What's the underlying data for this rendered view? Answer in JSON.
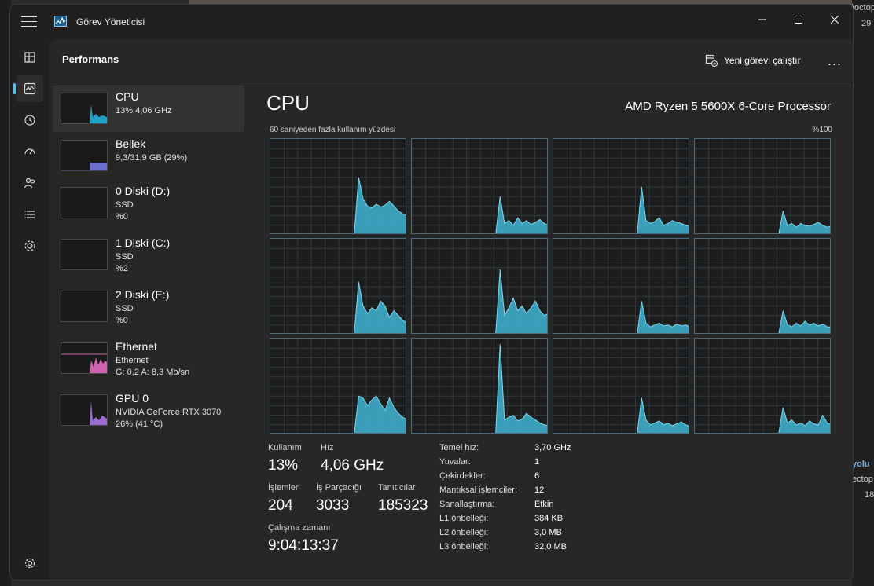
{
  "app": {
    "title": "Görev Yöneticisi"
  },
  "background": {
    "right_text_1": "\\octop",
    "right_text_2": "29",
    "right_text_3": "yolu",
    "right_text_4": "ectop",
    "right_text_5": "18"
  },
  "nav": {
    "items": [
      "performance-icon",
      "processes-icon",
      "history-icon",
      "startup-icon",
      "users-icon",
      "details-icon",
      "services-icon",
      "settings-icon"
    ]
  },
  "header": {
    "title": "Performans",
    "run_new_task": "Yeni görevi çalıştır",
    "more": "..."
  },
  "devices": [
    {
      "name": "CPU",
      "line1": "13% 4,06 GHz",
      "line2": "",
      "color": "#21a0c8"
    },
    {
      "name": "Bellek",
      "line1": "9,3/31,9 GB (29%)",
      "line2": "",
      "color": "#6b6fd0"
    },
    {
      "name": "0 Diski (D:)",
      "line1": "SSD",
      "line2": "%0",
      "color": "#63b95a"
    },
    {
      "name": "1 Diski (C:)",
      "line1": "SSD",
      "line2": "%2",
      "color": "#63b95a"
    },
    {
      "name": "2 Diski (E:)",
      "line1": "SSD",
      "line2": "%0",
      "color": "#63b95a"
    },
    {
      "name": "Ethernet",
      "line1": "Ethernet",
      "line2": "G: 0,2 A: 8,3 Mb/sn",
      "color": "#d063b0"
    },
    {
      "name": "GPU 0",
      "line1": "NVIDIA GeForce RTX 3070",
      "line2": "26% (41 °C)",
      "color": "#9a6bd0"
    }
  ],
  "cpu": {
    "title": "CPU",
    "model": "AMD Ryzen 5 5600X 6-Core Processor",
    "graph_label": "60 saniyeden fazla kullanım yüzdesi",
    "graph_max": "%100",
    "fill_color": "#3fb5d4",
    "line_color": "#7fd6ec"
  },
  "stats": {
    "usage_label": "Kullanım",
    "usage_value": "13%",
    "speed_label": "Hız",
    "speed_value": "4,06 GHz",
    "processes_label": "İşlemler",
    "processes_value": "204",
    "threads_label": "İş Parçacığı",
    "threads_value": "3033",
    "handles_label": "Tanıtıcılar",
    "handles_value": "185323",
    "uptime_label": "Çalışma zamanı",
    "uptime_value": "9:04:13:37"
  },
  "info": [
    {
      "key": "Temel hız:",
      "value": "3,70 GHz"
    },
    {
      "key": "Yuvalar:",
      "value": "1"
    },
    {
      "key": "Çekirdekler:",
      "value": "6"
    },
    {
      "key": "Mantıksal işlemciler:",
      "value": "12"
    },
    {
      "key": "Sanallaştırma:",
      "value": "Etkin"
    },
    {
      "key": "L1 önbelleği:",
      "value": "384 KB"
    },
    {
      "key": "L2 önbelleği:",
      "value": "3,0 MB"
    },
    {
      "key": "L3 önbelleği:",
      "value": "32,0 MB"
    }
  ],
  "chart_data": {
    "type": "area",
    "title": "60 saniyeden fazla kullanım yüzdesi",
    "ylim": [
      0,
      100
    ],
    "series": [
      {
        "values": [
          0,
          0,
          0,
          0,
          0,
          0,
          0,
          0,
          0,
          0,
          0,
          0,
          0,
          0,
          0,
          0,
          0,
          0,
          0,
          0,
          60,
          38,
          30,
          28,
          32,
          29,
          31,
          35,
          30,
          25,
          22,
          20
        ]
      },
      {
        "values": [
          0,
          0,
          0,
          0,
          0,
          0,
          0,
          0,
          0,
          0,
          0,
          0,
          0,
          0,
          0,
          0,
          0,
          0,
          0,
          0,
          40,
          12,
          15,
          10,
          18,
          12,
          15,
          11,
          13,
          16,
          12,
          10
        ]
      },
      {
        "values": [
          0,
          0,
          0,
          0,
          0,
          0,
          0,
          0,
          0,
          0,
          0,
          0,
          0,
          0,
          0,
          0,
          0,
          0,
          0,
          0,
          50,
          15,
          12,
          14,
          18,
          10,
          12,
          15,
          13,
          12,
          10,
          9
        ]
      },
      {
        "values": [
          0,
          0,
          0,
          0,
          0,
          0,
          0,
          0,
          0,
          0,
          0,
          0,
          0,
          0,
          0,
          0,
          0,
          0,
          0,
          0,
          25,
          10,
          12,
          8,
          12,
          10,
          9,
          11,
          13,
          10,
          8,
          9
        ]
      },
      {
        "values": [
          0,
          0,
          0,
          0,
          0,
          0,
          0,
          0,
          0,
          0,
          0,
          0,
          0,
          0,
          0,
          0,
          0,
          0,
          0,
          0,
          55,
          30,
          22,
          28,
          25,
          35,
          30,
          18,
          25,
          20,
          15,
          12
        ]
      },
      {
        "values": [
          0,
          0,
          0,
          0,
          0,
          0,
          0,
          0,
          0,
          0,
          0,
          0,
          0,
          0,
          0,
          0,
          0,
          0,
          0,
          0,
          68,
          20,
          28,
          38,
          25,
          30,
          22,
          28,
          35,
          25,
          20,
          22
        ]
      },
      {
        "values": [
          0,
          0,
          0,
          0,
          0,
          0,
          0,
          0,
          0,
          0,
          0,
          0,
          0,
          0,
          0,
          0,
          0,
          0,
          0,
          0,
          35,
          12,
          8,
          10,
          12,
          9,
          10,
          8,
          11,
          9,
          10,
          8
        ]
      },
      {
        "values": [
          0,
          0,
          0,
          0,
          0,
          0,
          0,
          0,
          0,
          0,
          0,
          0,
          0,
          0,
          0,
          0,
          0,
          0,
          0,
          0,
          25,
          10,
          8,
          12,
          9,
          14,
          10,
          12,
          9,
          11,
          8,
          8
        ]
      },
      {
        "values": [
          0,
          0,
          0,
          0,
          0,
          0,
          0,
          0,
          0,
          0,
          0,
          0,
          0,
          0,
          0,
          0,
          0,
          0,
          0,
          0,
          40,
          38,
          30,
          36,
          40,
          32,
          25,
          38,
          28,
          22,
          18,
          15
        ]
      },
      {
        "values": [
          0,
          0,
          0,
          0,
          0,
          0,
          0,
          0,
          0,
          0,
          0,
          0,
          0,
          0,
          0,
          0,
          0,
          0,
          0,
          0,
          94,
          15,
          18,
          20,
          14,
          16,
          22,
          18,
          15,
          12,
          10,
          9
        ]
      },
      {
        "values": [
          0,
          0,
          0,
          0,
          0,
          0,
          0,
          0,
          0,
          0,
          0,
          0,
          0,
          0,
          0,
          0,
          0,
          0,
          0,
          0,
          38,
          15,
          10,
          12,
          14,
          10,
          12,
          9,
          11,
          13,
          10,
          8
        ]
      },
      {
        "values": [
          0,
          0,
          0,
          0,
          0,
          0,
          0,
          0,
          0,
          0,
          0,
          0,
          0,
          0,
          0,
          0,
          0,
          0,
          0,
          0,
          28,
          12,
          15,
          10,
          12,
          9,
          14,
          11,
          10,
          20,
          12,
          10
        ]
      }
    ]
  }
}
